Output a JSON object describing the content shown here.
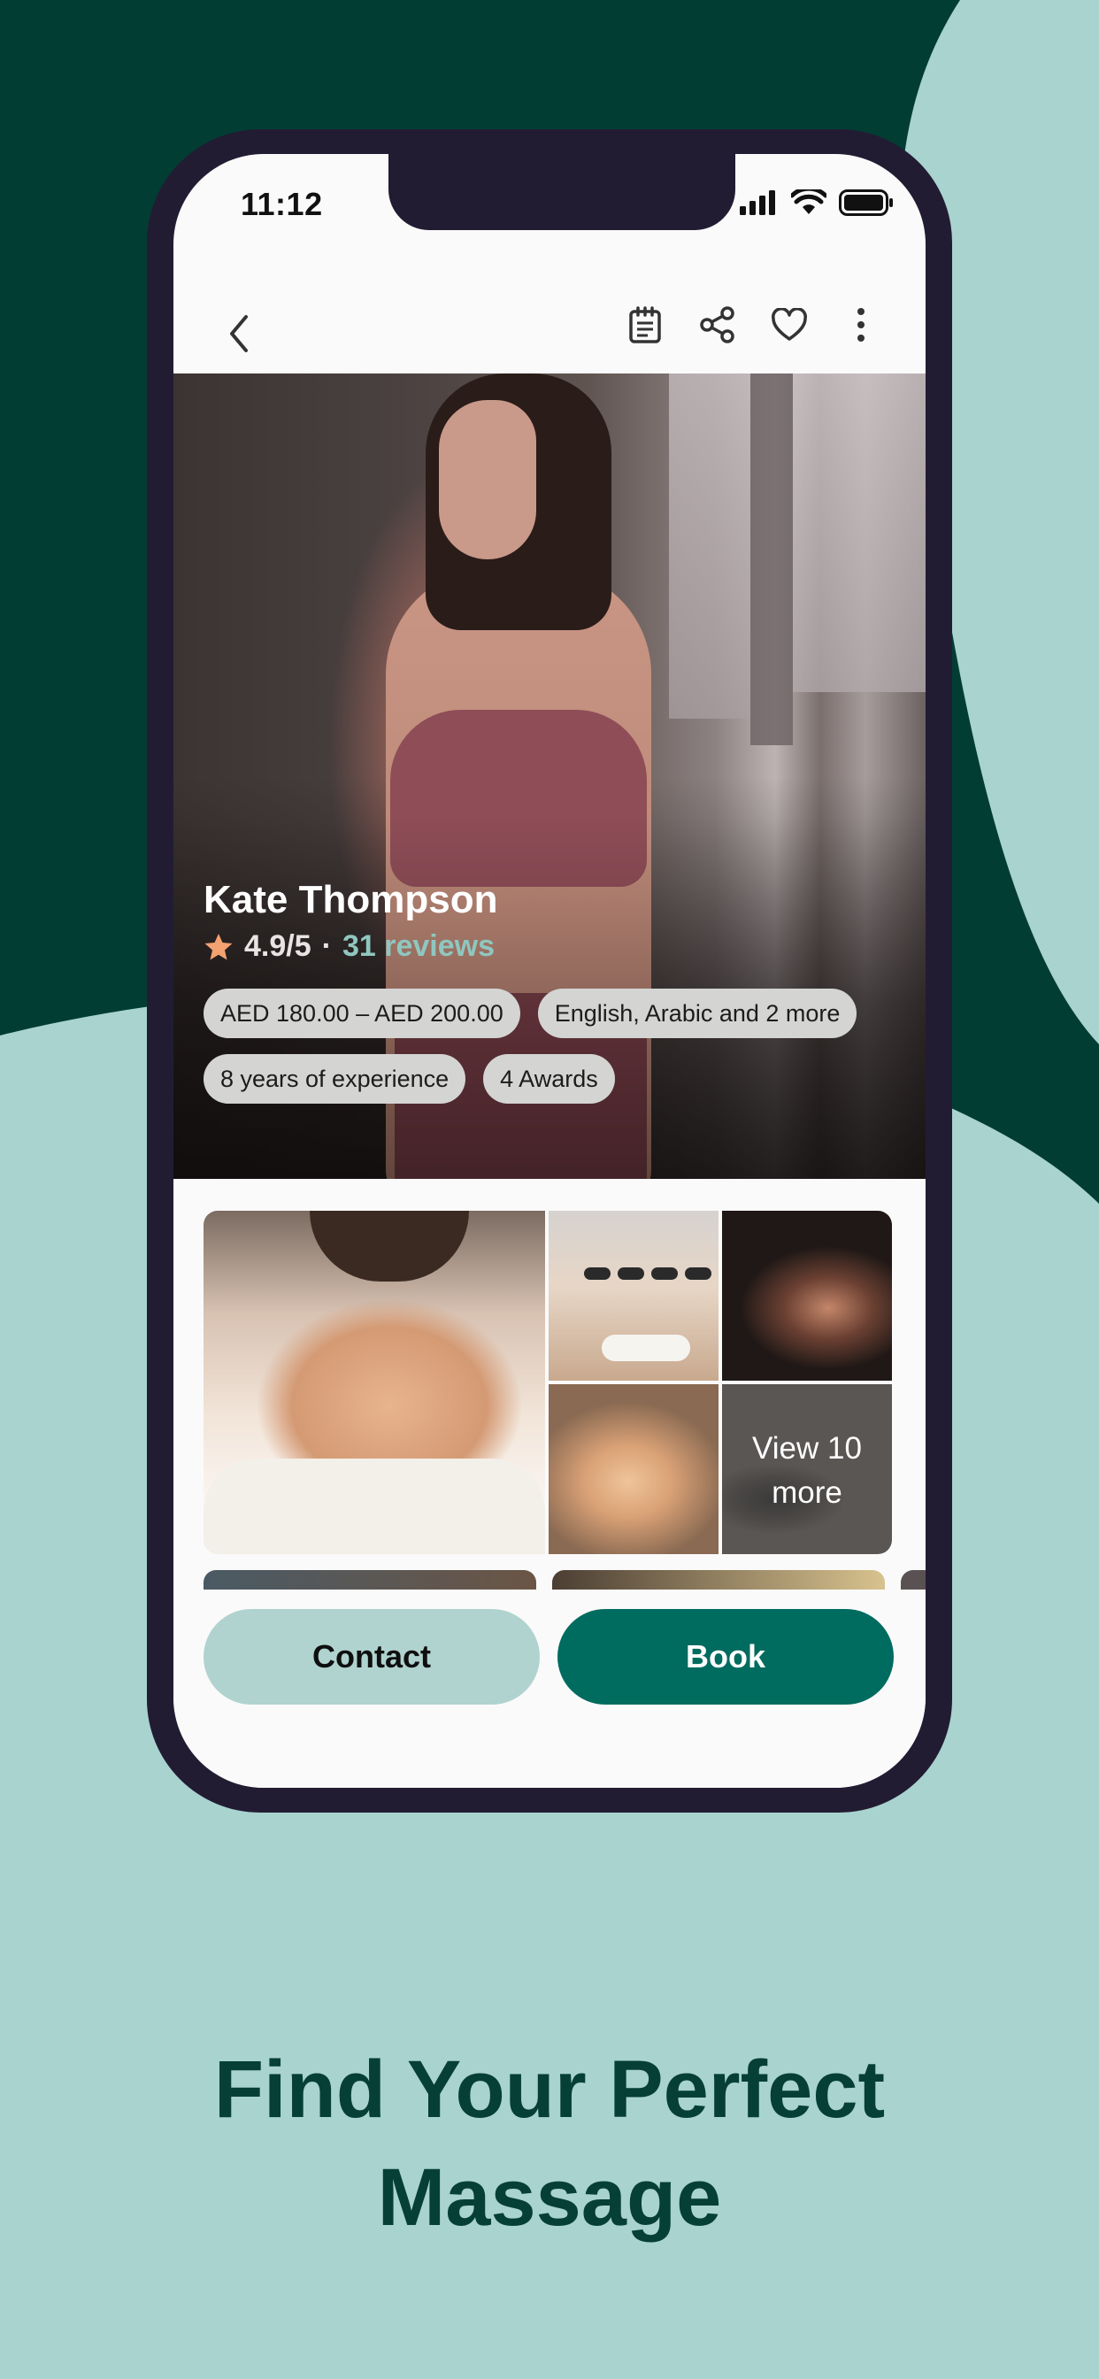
{
  "colors": {
    "background": "#a9d3cf",
    "dark_green": "#023d33",
    "brand_teal": "#006b5f",
    "contact_button": "#b0d3cf",
    "star": "#f3a170",
    "reviews_link": "#8fc7c0",
    "phone_frame": "#221c33",
    "headline": "#053f36"
  },
  "status_bar": {
    "time": "11:12",
    "icons": [
      "cellular-signal-icon",
      "wifi-icon",
      "battery-icon"
    ]
  },
  "toolbar": {
    "icons": [
      "back-chevron-icon",
      "notepad-icon",
      "share-icon",
      "heart-icon",
      "more-vertical-icon"
    ]
  },
  "profile": {
    "name": "Kate Thompson",
    "rating": "4.9/5",
    "separator": "·",
    "reviews": "31 reviews",
    "chips": [
      "AED 180.00 – AED 200.00",
      "English, Arabic and 2 more",
      "8 years of experience",
      "4 Awards"
    ]
  },
  "gallery": {
    "more_label": "View 10 more"
  },
  "actions": {
    "contact": "Contact",
    "book": "Book"
  },
  "headline": {
    "line1": "Find Your Perfect",
    "line2": "Massage"
  }
}
